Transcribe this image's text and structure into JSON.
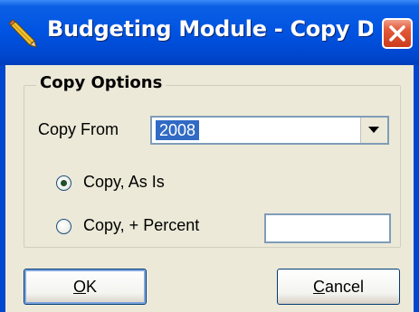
{
  "window": {
    "title": "Budgeting Module - Copy Di...",
    "icon": "pencil-icon",
    "close_icon": "close-icon"
  },
  "copy_options": {
    "group_title": "Copy Options",
    "copy_from_label": "Copy From",
    "copy_from_value": "2008",
    "dropdown_icon": "chevron-down-icon",
    "radio_as_is_label": "Copy, As Is",
    "radio_as_is_selected": true,
    "radio_percent_label": "Copy, + Percent",
    "radio_percent_selected": false,
    "percent_value": ""
  },
  "buttons": {
    "ok_mnemonic": "O",
    "ok_rest": "K",
    "cancel_mnemonic": "C",
    "cancel_rest": "ancel"
  },
  "colors": {
    "titlebar": "#0053e1",
    "selection": "#316ac5",
    "close_button": "#e35b3b"
  }
}
